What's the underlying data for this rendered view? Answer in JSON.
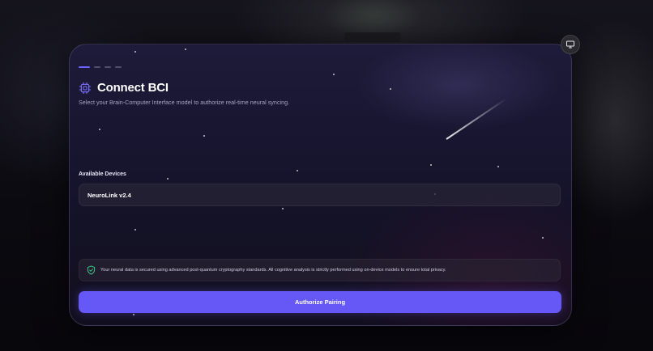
{
  "header": {
    "title": "Connect BCI",
    "subtitle": "Select your Brain-Computer Interface model to authorize real-time neural syncing.",
    "title_icon": "cpu-chip-icon"
  },
  "progress": {
    "total_steps": 4,
    "current_step": 1
  },
  "devices": {
    "label": "Available Devices",
    "items": [
      {
        "name": "NeuroLink v2.4"
      }
    ]
  },
  "notice": {
    "icon": "shield-check-icon",
    "text": "Your neural data is secured using advanced post-quantum cryptography standards. All cognitive analysis is strictly performed using on-device models to ensure total privacy."
  },
  "actions": {
    "authorize_label": "Authorize Pairing"
  },
  "top_right": {
    "icon": "monitor-icon"
  },
  "colors": {
    "accent": "#6658f6",
    "shield": "#3ecf8e"
  }
}
